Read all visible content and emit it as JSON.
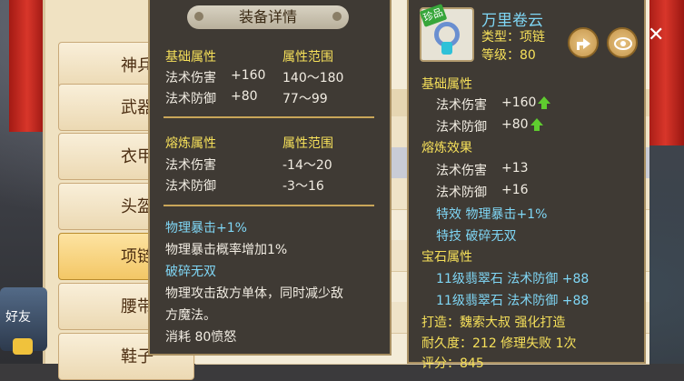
{
  "background": {
    "category_tabs": [
      "神兵",
      "武器",
      "衣甲",
      "头盔",
      "项链",
      "腰带",
      "鞋子"
    ],
    "selected_category": "项链",
    "avatar_text": "好友"
  },
  "tooltip_left": {
    "title": "装备详情",
    "base_header": "基础属性",
    "base_range_header": "属性范围",
    "base_rows": [
      {
        "name": "法术伤害",
        "value": "+160",
        "range": "140～180"
      },
      {
        "name": "法术防御",
        "value": "+80",
        "range": "77～99"
      }
    ],
    "refine_header": "熔炼属性",
    "refine_range_header": "属性范围",
    "refine_rows": [
      {
        "name": "法术伤害",
        "range": "-14～20"
      },
      {
        "name": "法术防御",
        "range": "-3～16"
      }
    ],
    "special1_title": "物理暴击+1%",
    "special1_desc": "物理暴击概率增加1%",
    "special2_title": "破碎无双",
    "special2_desc_line1": "物理攻击敌方单体，同时减少敌",
    "special2_desc_line2": "方魔法。",
    "special2_cost": "消耗 80愤怒"
  },
  "tooltip_right": {
    "item_name": "万里卷云",
    "badge": "珍品",
    "type_line": "类型：项链",
    "level_line": "等级：80",
    "base_header": "基础属性",
    "base_rows": [
      {
        "name": "法术伤害",
        "value": "+160"
      },
      {
        "name": "法术防御",
        "value": "+80"
      }
    ],
    "refine_header": "熔炼效果",
    "refine_rows": [
      {
        "name": "法术伤害",
        "value": "+13"
      },
      {
        "name": "法术防御",
        "value": "+16"
      }
    ],
    "special_effect": "特效  物理暴击+1%",
    "special_skill": "特技  破碎无双",
    "gem_header": "宝石属性",
    "gems": [
      "11级翡翠石 法术防御 +88",
      "11级翡翠石 法术防御 +88"
    ],
    "craft_line": "打造：魏索大叔  强化打造",
    "durability_line": "耐久度：212 修理失败 1次",
    "score_line": "评分：845"
  },
  "colors": {
    "yellow": "#f6e05a",
    "white": "#f1ece2",
    "cyan": "#7fd6f5",
    "green_arrow": "#5fcc2f"
  },
  "icons": [
    "share-icon",
    "eye-icon",
    "close-icon",
    "arrow-up-icon"
  ]
}
